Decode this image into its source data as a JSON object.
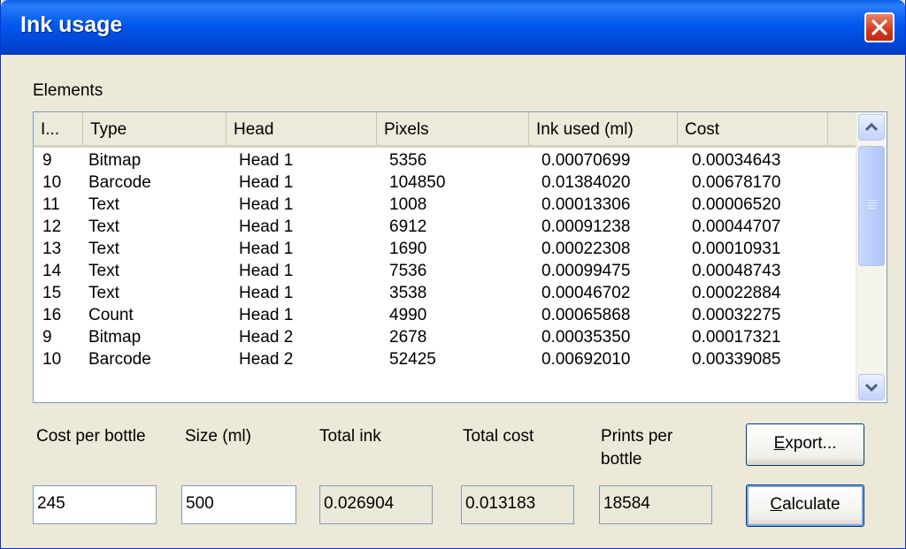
{
  "window": {
    "title": "Ink usage"
  },
  "elements_label": "Elements",
  "columns": [
    "I...",
    "Type",
    "Head",
    "Pixels",
    "Ink used (ml)",
    "Cost"
  ],
  "rows": [
    [
      "9",
      "Bitmap",
      "Head 1",
      "5356",
      "0.00070699",
      "0.00034643"
    ],
    [
      "10",
      "Barcode",
      "Head 1",
      "104850",
      "0.01384020",
      "0.00678170"
    ],
    [
      "11",
      "Text",
      "Head 1",
      "1008",
      "0.00013306",
      "0.00006520"
    ],
    [
      "12",
      "Text",
      "Head 1",
      "6912",
      "0.00091238",
      "0.00044707"
    ],
    [
      "13",
      "Text",
      "Head 1",
      "1690",
      "0.00022308",
      "0.00010931"
    ],
    [
      "14",
      "Text",
      "Head 1",
      "7536",
      "0.00099475",
      "0.00048743"
    ],
    [
      "15",
      "Text",
      "Head 1",
      "3538",
      "0.00046702",
      "0.00022884"
    ],
    [
      "16",
      "Count",
      "Head 1",
      "4990",
      "0.00065868",
      "0.00032275"
    ],
    [
      "9",
      "Bitmap",
      "Head 2",
      "2678",
      "0.00035350",
      "0.00017321"
    ],
    [
      "10",
      "Barcode",
      "Head 2",
      "52425",
      "0.00692010",
      "0.00339085"
    ]
  ],
  "fields": {
    "cost_per_bottle": {
      "label": "Cost per bottle",
      "value": "245"
    },
    "size_ml": {
      "label": "Size (ml)",
      "value": "500"
    },
    "total_ink": {
      "label": "Total ink",
      "value": "0.026904"
    },
    "total_cost": {
      "label": "Total cost",
      "value": "0.013183"
    },
    "prints_per_bottle": {
      "label_line1": "Prints per",
      "label_line2": "bottle",
      "value": "18584"
    }
  },
  "buttons": {
    "export": {
      "accel": "E",
      "rest": "xport..."
    },
    "calculate": {
      "accel": "C",
      "rest": "alculate"
    }
  },
  "icons": {
    "close": "close-x-icon",
    "scroll_up": "chevron-up-icon",
    "scroll_down": "chevron-down-icon"
  }
}
